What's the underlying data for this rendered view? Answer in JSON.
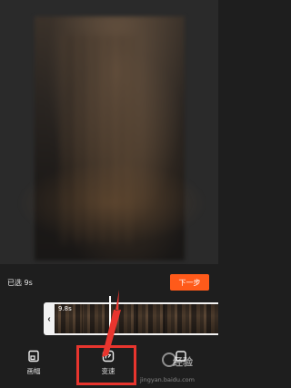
{
  "preview": {
    "description_icon": "video-preview"
  },
  "selection": {
    "selected_text": "已选 9s",
    "next_label": "下一步"
  },
  "timeline": {
    "duration": "9.8s",
    "trim_arrow": "‹"
  },
  "toolbar": {
    "items": [
      {
        "label": "画幅",
        "icon": "frame-icon"
      },
      {
        "label": "变速",
        "icon": "speed-icon"
      },
      {
        "label": "",
        "icon": "tool-icon"
      }
    ]
  },
  "watermark": {
    "text": "经验",
    "url": "jingyan.baidu.com"
  },
  "colors": {
    "accent": "#ff5a1a",
    "highlight": "#e8352e",
    "background": "#1e1e1e"
  }
}
